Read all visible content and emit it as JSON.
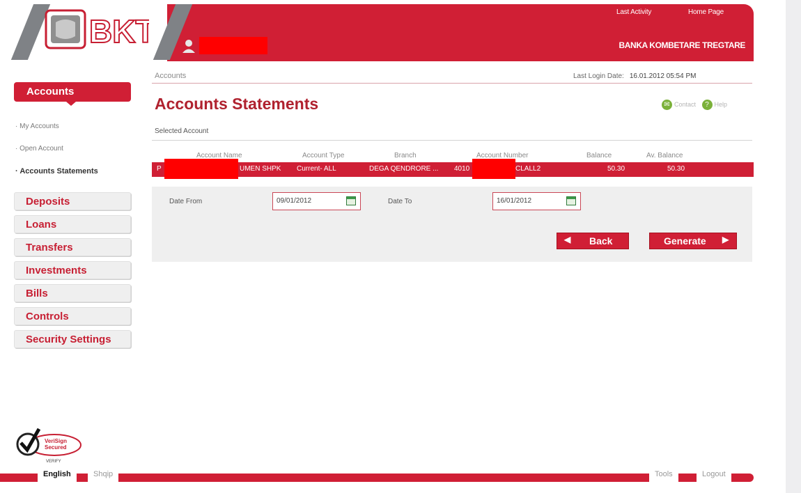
{
  "header": {
    "logo_text": "BKT",
    "links": [
      "Last Activity",
      "Home Page"
    ],
    "bank_name": "BANKA KOMBETARE TREGTARE"
  },
  "breadcrumb": "Accounts",
  "last_login": {
    "label": "Last Login Date:",
    "value": "16.01.2012 05:54 PM"
  },
  "sidebar": {
    "main": "Accounts",
    "sub": [
      "My Accounts",
      "Open Account",
      "Accounts Statements"
    ],
    "items": [
      "Deposits",
      "Loans",
      "Transfers",
      "Investments",
      "Bills",
      "Controls",
      "Security Settings"
    ]
  },
  "main": {
    "title": "Accounts Statements",
    "tools": [
      "Contact",
      "Help"
    ],
    "selected_account_label": "Selected Account",
    "columns": [
      "Account Name",
      "Account Type",
      "Branch",
      "Account Number",
      "Balance",
      "Av. Balance"
    ],
    "row": {
      "name_prefix": "P",
      "name_suffix": "UMEN SHPK",
      "type": "Current- ALL",
      "branch": "DEGA QENDRORE ...",
      "number_prefix": "4010",
      "number_suffix": "CLALL2",
      "balance": "50.30",
      "av_balance": "50.30"
    },
    "form": {
      "date_from_label": "Date From",
      "date_from": "09/01/2012",
      "date_to_label": "Date To",
      "date_to": "16/01/2012",
      "back_label": "Back",
      "generate_label": "Generate"
    }
  },
  "footer": {
    "verisign": {
      "line1": "VeriSign",
      "line2": "Secured",
      "line3": "VERIFY"
    },
    "left_tabs": [
      "English",
      "Shqip"
    ],
    "right_tabs": [
      "Tools",
      "Logout"
    ]
  },
  "colors": {
    "brand_red": "#d01f35",
    "title_red": "#b0222f",
    "panel_gray": "#efefef"
  }
}
